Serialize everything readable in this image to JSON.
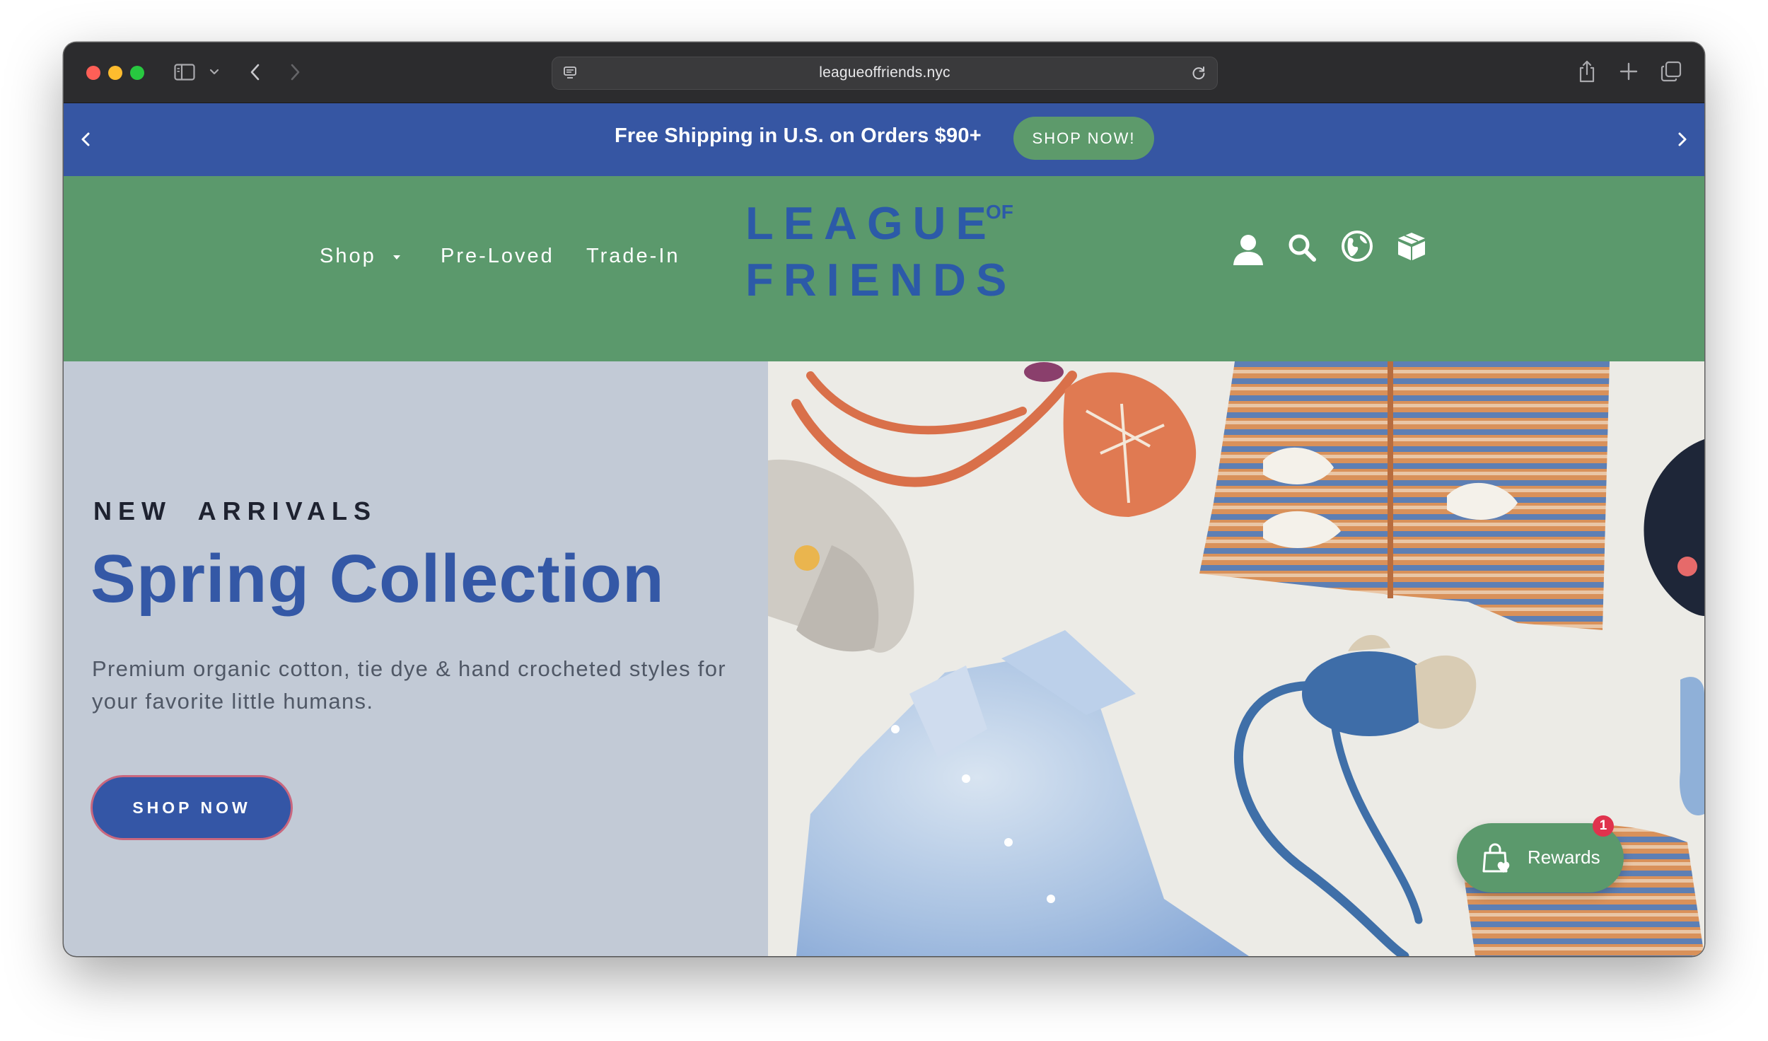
{
  "browser": {
    "url": "leagueoffriends.nyc"
  },
  "announcement": {
    "text": "Free Shipping in U.S. on Orders $90+",
    "cta_label": "SHOP NOW!"
  },
  "header": {
    "nav": [
      {
        "label": "Shop",
        "has_dropdown": true
      },
      {
        "label": "Pre-Loved"
      },
      {
        "label": "Trade-In"
      }
    ],
    "logo": {
      "line1": "LEAGUE",
      "of": "OF",
      "line2": "FRIENDS"
    },
    "icons": [
      "account-icon",
      "search-icon",
      "globe-icon",
      "box-icon"
    ]
  },
  "hero": {
    "eyebrow": "NEW  ARRIVALS",
    "title": "Spring Collection",
    "subtitle": "Premium organic cotton, tie dye & hand crocheted styles for your favorite little humans.",
    "cta_label": "SHOP NOW"
  },
  "rewards": {
    "label": "Rewards",
    "badge_count": "1"
  },
  "colors": {
    "announcement_bg": "#3656a3",
    "header_bg": "#5b996c",
    "hero_left_bg": "#c2cad6",
    "brand_blue": "#3458a6",
    "cta_border": "#c9677e",
    "badge": "#e0334d"
  }
}
